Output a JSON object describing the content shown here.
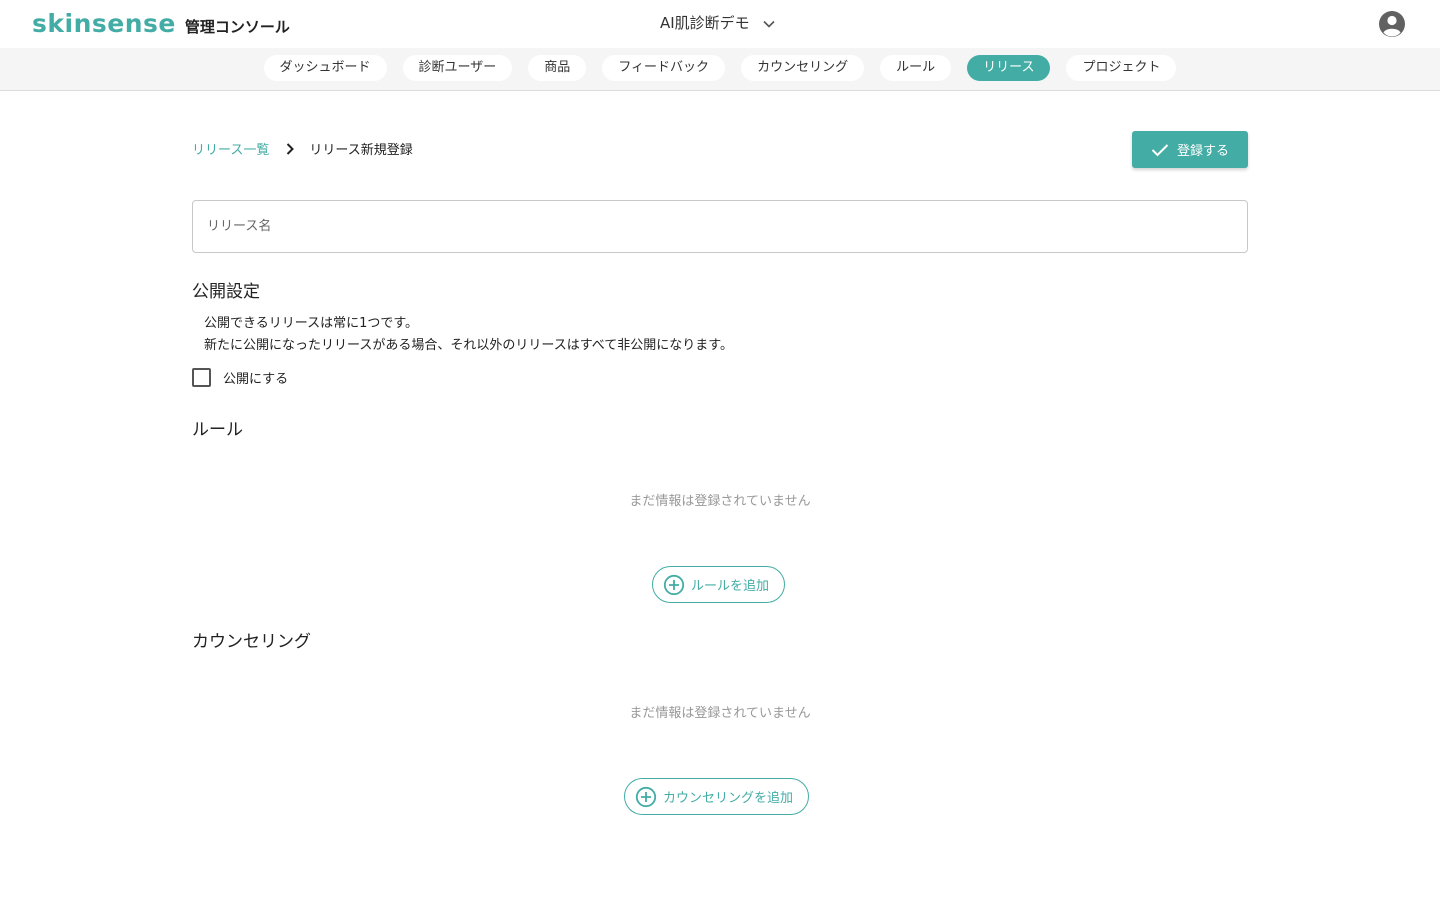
{
  "header": {
    "brand": "skinsense",
    "subtitle": "管理コンソール",
    "project": "AI肌診断デモ",
    "account_icon": "account-circle-icon"
  },
  "nav": {
    "tabs": [
      {
        "label": "ダッシュボード",
        "active": false
      },
      {
        "label": "診断ユーザー",
        "active": false
      },
      {
        "label": "商品",
        "active": false
      },
      {
        "label": "フィードバック",
        "active": false
      },
      {
        "label": "カウンセリング",
        "active": false
      },
      {
        "label": "ルール",
        "active": false
      },
      {
        "label": "リリース",
        "active": true
      },
      {
        "label": "プロジェクト",
        "active": false
      }
    ]
  },
  "breadcrumb": {
    "parent": "リリース一覧",
    "current": "リリース新規登録"
  },
  "form": {
    "submit_label": "登録する",
    "name_placeholder": "リリース名",
    "name_value": ""
  },
  "publish": {
    "title": "公開設定",
    "notice_line1": "公開できるリリースは常に1つです。",
    "notice_line2": "新たに公開になったリリースがある場合、それ以外のリリースはすべて非公開になります。",
    "checkbox_label": "公開にする",
    "checked": false
  },
  "rules": {
    "title": "ルール",
    "empty": "まだ情報は登録されていません",
    "add_label": "ルールを追加"
  },
  "counseling": {
    "title": "カウンセリング",
    "empty": "まだ情報は登録されていません",
    "add_label": "カウンセリングを追加"
  },
  "colors": {
    "accent": "#43aca5",
    "nav_bg": "#f5f5f5",
    "muted_text": "#999999"
  }
}
